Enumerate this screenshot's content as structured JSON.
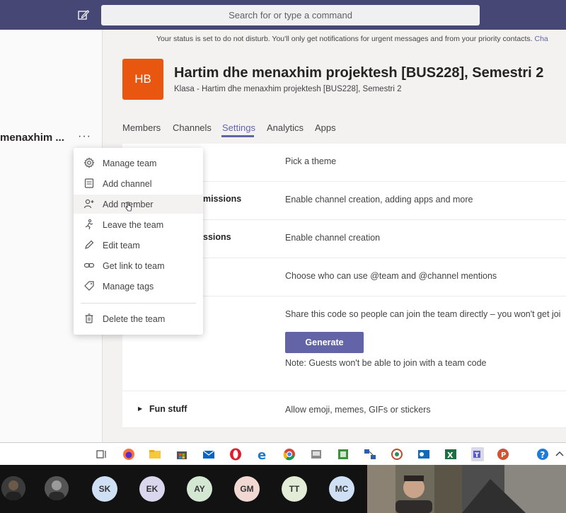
{
  "topbar": {
    "search_placeholder": "Search for or type a command",
    "compose_icon": "compose-icon"
  },
  "status_bar": {
    "message": "Your status is set to do not disturb. You'll only get notifications for urgent messages and from your priority contacts.",
    "change_link": "Cha"
  },
  "left_panel": {
    "team_name": "menaxhim ...",
    "more_label": "···"
  },
  "team": {
    "avatar_initials": "HB",
    "avatar_color": "#e8560f",
    "title": "Hartim dhe menaxhim projektesh [BUS228], Semestri 2",
    "subtitle": "Klasa - Hartim dhe menaxhim projektesh [BUS228], Semestri 2"
  },
  "tabs": [
    {
      "label": "Members",
      "active": false
    },
    {
      "label": "Channels",
      "active": false
    },
    {
      "label": "Settings",
      "active": true
    },
    {
      "label": "Analytics",
      "active": false
    },
    {
      "label": "Apps",
      "active": false
    }
  ],
  "settings_rows": [
    {
      "title": "",
      "description": "Pick a theme"
    },
    {
      "title": "missions",
      "description": "Enable channel creation, adding apps and more"
    },
    {
      "title": "ssions",
      "description": "Enable channel creation"
    },
    {
      "title": "",
      "description": "Choose who can use @team and @channel mentions"
    },
    {
      "title": "",
      "description": "Share this code so people can join the team directly – you won't get joi"
    },
    {
      "title": "Fun stuff",
      "description": "Allow emoji, memes, GIFs or stickers"
    }
  ],
  "team_code": {
    "button_label": "Generate",
    "note": "Note: Guests won't be able to join with a team code"
  },
  "context_menu": {
    "items": [
      {
        "label": "Manage team",
        "icon": "gear-icon"
      },
      {
        "label": "Add channel",
        "icon": "channel-icon"
      },
      {
        "label": "Add member",
        "icon": "add-person-icon",
        "hover": true
      },
      {
        "label": "Leave the team",
        "icon": "leave-icon"
      },
      {
        "label": "Edit team",
        "icon": "pencil-icon"
      },
      {
        "label": "Get link to team",
        "icon": "link-icon"
      },
      {
        "label": "Manage tags",
        "icon": "tag-icon"
      },
      {
        "label": "Delete the team",
        "icon": "trash-icon"
      }
    ]
  },
  "meeting": {
    "participants": [
      {
        "initials": "SK",
        "color": "#cfe0f5"
      },
      {
        "initials": "EK",
        "color": "#d9d6ee"
      },
      {
        "initials": "AY",
        "color": "#d3e7d3"
      },
      {
        "initials": "GM",
        "color": "#f1d8d2"
      },
      {
        "initials": "TT",
        "color": "#e2ecd6"
      },
      {
        "initials": "MC",
        "color": "#cfe0f5"
      }
    ]
  },
  "colors": {
    "brand": "#6264a7",
    "topbar": "#464775"
  }
}
